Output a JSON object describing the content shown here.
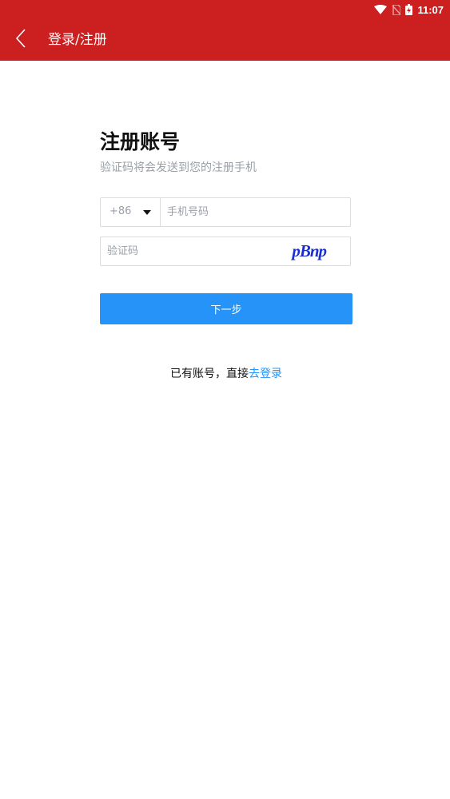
{
  "status_bar": {
    "time": "11:07",
    "icons": [
      "wifi-icon",
      "no-sim-icon",
      "battery-charging-icon"
    ]
  },
  "app_bar": {
    "back_icon": "chevron-left-icon",
    "title": "登录/注册",
    "background": "#cc1f20"
  },
  "form": {
    "heading": "注册账号",
    "subheading": "验证码将会发送到您的注册手机",
    "country_code": "+86",
    "phone_placeholder": "手机号码",
    "code_placeholder": "验证码",
    "captcha_text": "pBnp",
    "next_label": "下一步",
    "accent": "#2593f8"
  },
  "footer": {
    "hint_text": "已有账号，直接",
    "login_link": "去登录"
  }
}
